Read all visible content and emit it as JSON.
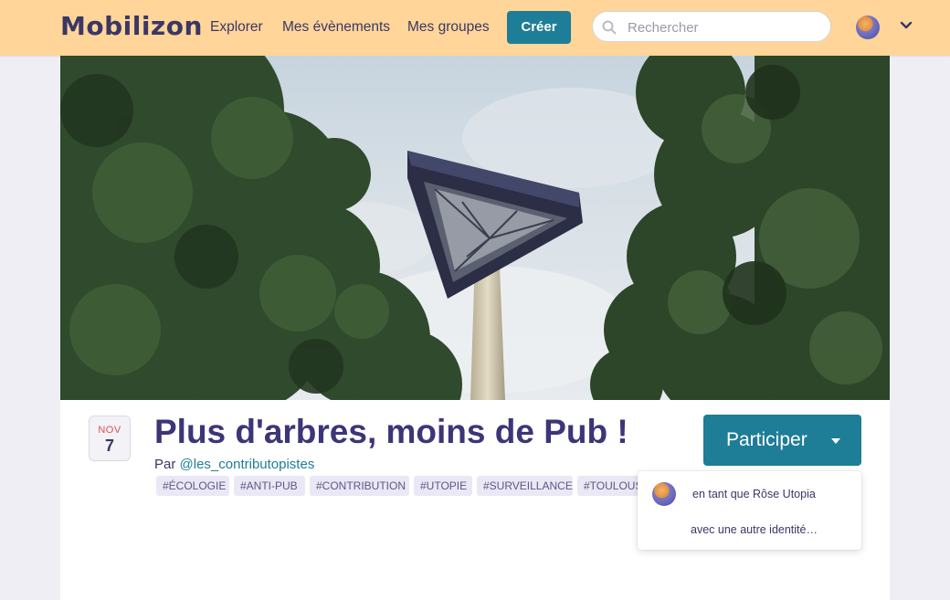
{
  "header": {
    "logo": "Mobilizon",
    "nav": [
      "Explorer",
      "Mes évènements",
      "Mes groupes"
    ],
    "create_label": "Créer",
    "search_placeholder": "Rechercher",
    "bg_color": "#ffd599",
    "accent_color": "#1e7d97"
  },
  "event": {
    "date_month": "NOV",
    "date_day": "7",
    "title": "Plus d'arbres, moins de Pub !",
    "by_prefix": "Par",
    "organizer": "@les_contributopistes",
    "tags": [
      "#ÉCOLOGIE",
      "#ANTI-PUB",
      "#CONTRIBUTION",
      "#UTOPIE",
      "#SURVEILLANCE",
      "#TOULOUSE"
    ]
  },
  "participate": {
    "label": "Participer",
    "options": [
      "en tant que Rôse Utopia",
      "avec une autre identité…"
    ]
  }
}
